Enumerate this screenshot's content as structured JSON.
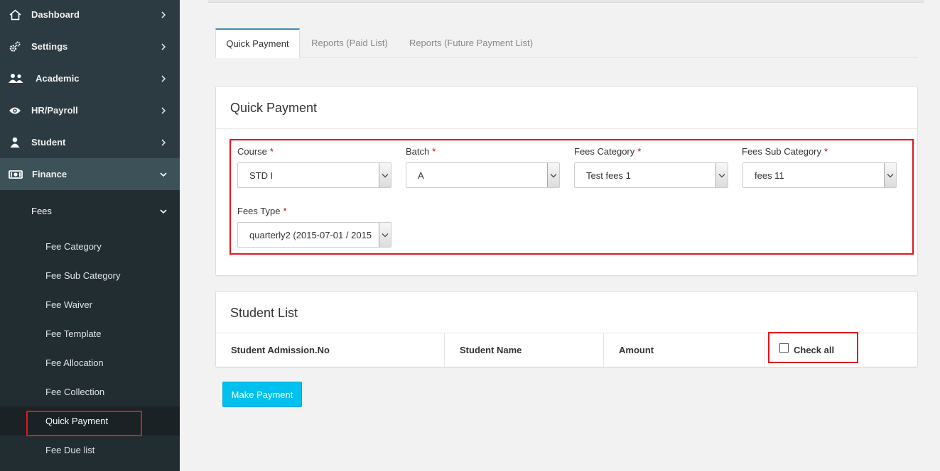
{
  "sidebar": {
    "items": [
      {
        "label": "Dashboard",
        "icon": "home-icon"
      },
      {
        "label": "Settings",
        "icon": "gears-icon"
      },
      {
        "label": "Academic",
        "icon": "users-icon"
      },
      {
        "label": "HR/Payroll",
        "icon": "eye-icon"
      },
      {
        "label": "Student",
        "icon": "user-icon"
      },
      {
        "label": "Finance",
        "icon": "money-icon"
      }
    ],
    "fees_label": "Fees",
    "sub_items": [
      "Fee Category",
      "Fee Sub Category",
      "Fee Waiver",
      "Fee Template",
      "Fee Allocation",
      "Fee Collection",
      "Quick Payment",
      "Fee Due list"
    ]
  },
  "tabs": [
    "Quick Payment",
    "Reports (Paid List)",
    "Reports (Future Payment List)"
  ],
  "quick_payment": {
    "title": "Quick Payment",
    "required_mark": "*",
    "fields": {
      "course": {
        "label": "Course",
        "value": "STD I"
      },
      "batch": {
        "label": "Batch",
        "value": "A"
      },
      "fees_category": {
        "label": "Fees Category",
        "value": "Test fees 1"
      },
      "fees_sub_category": {
        "label": "Fees Sub Category",
        "value": "fees 11"
      },
      "fees_type": {
        "label": "Fees Type",
        "value": "quarterly2 (2015-07-01 / 2015"
      }
    }
  },
  "student_list": {
    "title": "Student List",
    "columns": [
      "Student Admission.No",
      "Student Name",
      "Amount"
    ],
    "check_all_label": "Check all"
  },
  "make_payment_label": "Make Payment",
  "colors": {
    "sidebar_bg": "#2c3b41",
    "sub_bg": "#222d32",
    "highlight": "#e4141b",
    "primary_button": "#00c0ef",
    "tab_accent": "#3c8dbc"
  }
}
